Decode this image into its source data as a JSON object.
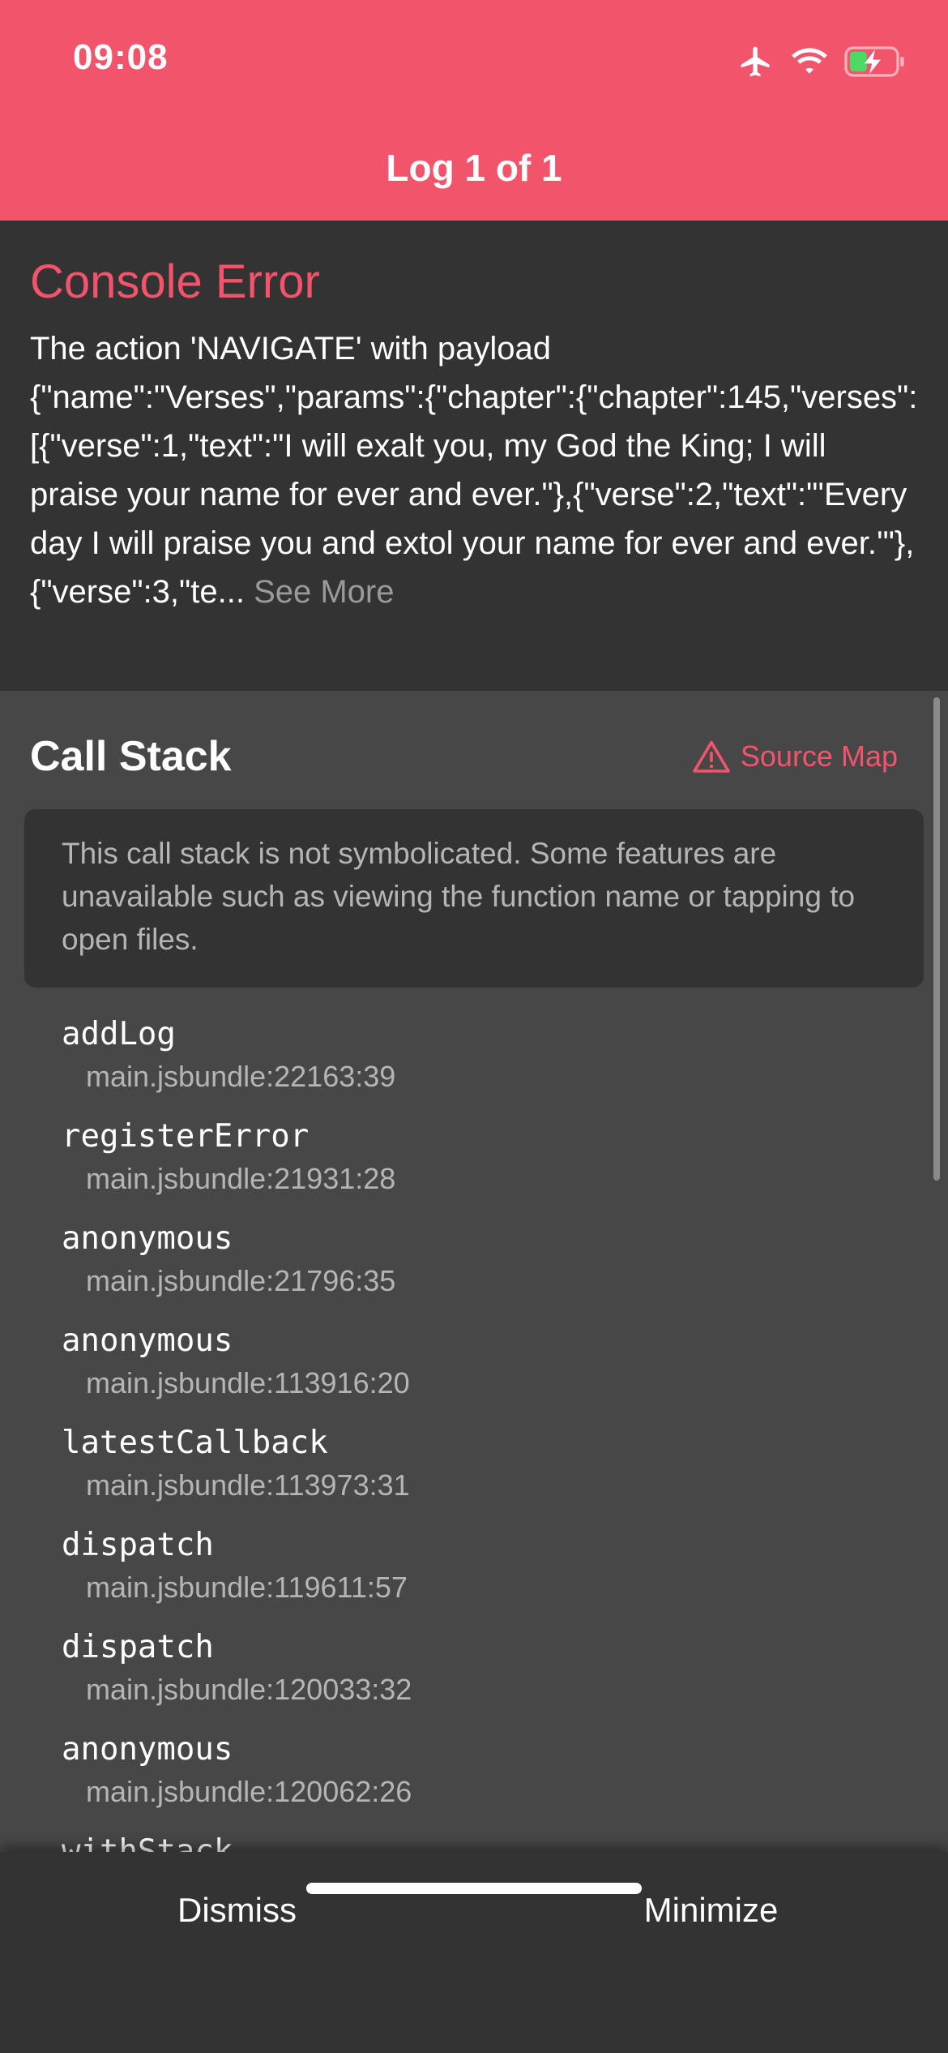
{
  "status_bar": {
    "time": "09:08",
    "icons": [
      "airplane-mode-icon",
      "wifi-icon",
      "battery-charging-icon"
    ]
  },
  "header": {
    "title": "Log 1 of 1"
  },
  "error": {
    "type": "Console Error",
    "message": "The action 'NAVIGATE' with payload {\"name\":\"Verses\",\"params\":{\"chapter\":{\"chapter\":145,\"verses\":[{\"verse\":1,\"text\":\"I will exalt you, my God the King; I will praise your name for ever and ever.\"},{\"verse\":2,\"text\":\"'Every day I will praise you and extol your name for ever and ever.'\"},{\"verse\":3,\"te...",
    "see_more_label": " See More"
  },
  "call_stack": {
    "title": "Call Stack",
    "source_map_label": "Source Map",
    "notice": "This call stack is not symbolicated. Some features are unavailable such as viewing the function name or tapping to open files.",
    "frames": [
      {
        "name": "addLog",
        "file": "main.jsbundle:22163:39"
      },
      {
        "name": "registerError",
        "file": "main.jsbundle:21931:28"
      },
      {
        "name": "anonymous",
        "file": "main.jsbundle:21796:35"
      },
      {
        "name": "anonymous",
        "file": "main.jsbundle:113916:20"
      },
      {
        "name": "latestCallback",
        "file": "main.jsbundle:113973:31"
      },
      {
        "name": "dispatch",
        "file": "main.jsbundle:119611:57"
      },
      {
        "name": "dispatch",
        "file": "main.jsbundle:120033:32"
      },
      {
        "name": "anonymous",
        "file": "main.jsbundle:120062:26"
      },
      {
        "name": "withStack",
        "file": ""
      }
    ]
  },
  "footer": {
    "dismiss_label": "Dismiss",
    "minimize_label": "Minimize"
  },
  "colors": {
    "accent": "#f2546b",
    "header_bg": "#f2546b",
    "message_bg": "#333333",
    "stack_bg": "#474747",
    "battery_fill": "#4cd964"
  }
}
